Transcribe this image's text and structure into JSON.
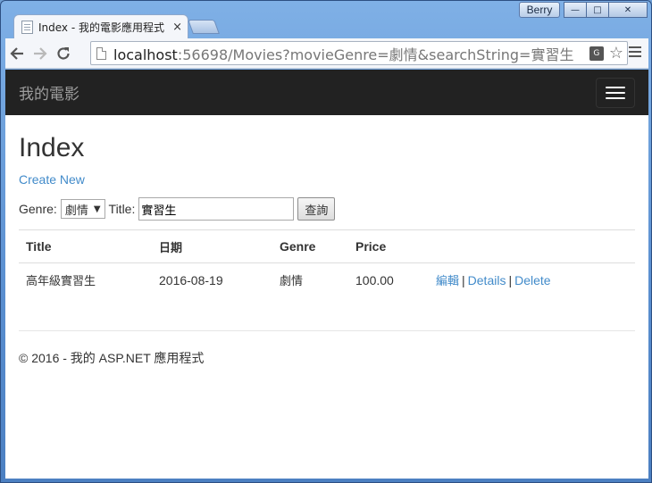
{
  "window": {
    "user": "Berry",
    "controls": {
      "minimize": "—",
      "maximize": "□",
      "close": "✕"
    }
  },
  "browser": {
    "tab_title": "Index - 我的電影應用程式",
    "tab_close": "×",
    "url_host": "localhost",
    "url_rest": ":56698/Movies?movieGenre=劇情&searchString=實習生"
  },
  "site": {
    "brand": "我的電影"
  },
  "page": {
    "title": "Index",
    "create_link": "Create New",
    "filter": {
      "genre_label": "Genre:",
      "genre_value": "劇情",
      "title_label": "Title:",
      "title_value": "實習生",
      "submit": "查詢"
    },
    "table": {
      "headers": [
        "Title",
        "日期",
        "Genre",
        "Price"
      ],
      "rows": [
        {
          "title": "高年級實習生",
          "date": "2016-08-19",
          "genre": "劇情",
          "price": "100.00",
          "edit": "編輯",
          "details": "Details",
          "delete": "Delete"
        }
      ]
    },
    "footer": "© 2016 - 我的 ASP.NET 應用程式"
  }
}
